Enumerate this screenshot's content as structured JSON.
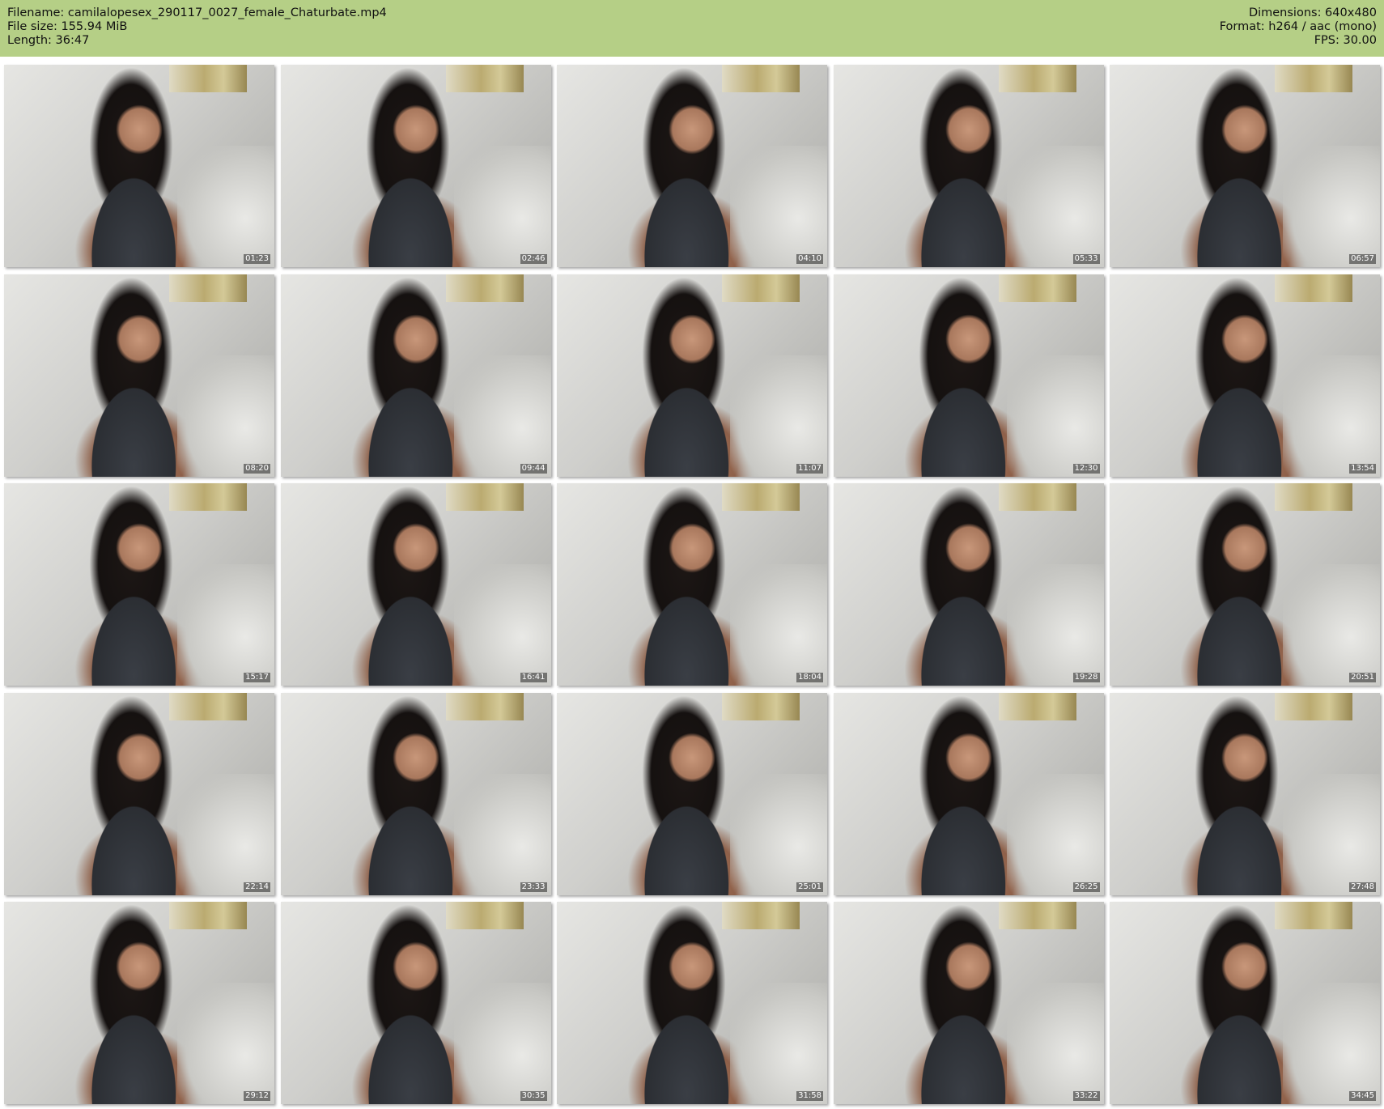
{
  "info": {
    "filename_line": "Filename: camilalopesex_290117_0027_female_Chaturbate.mp4",
    "filesize_line": "File size: 155.94 MiB",
    "length_line": "Length: 36:47",
    "dimensions_line": "Dimensions: 640x480",
    "format_line": "Format: h264 / aac (mono)",
    "fps_line": "FPS: 30.00"
  },
  "colors": {
    "header_background": "#b5cf86",
    "page_background": "#ffffff"
  },
  "thumbnails": [
    {
      "timestamp": "01:23"
    },
    {
      "timestamp": "02:46"
    },
    {
      "timestamp": "04:10"
    },
    {
      "timestamp": "05:33"
    },
    {
      "timestamp": "06:57"
    },
    {
      "timestamp": "08:20"
    },
    {
      "timestamp": "09:44"
    },
    {
      "timestamp": "11:07"
    },
    {
      "timestamp": "12:30"
    },
    {
      "timestamp": "13:54"
    },
    {
      "timestamp": "15:17"
    },
    {
      "timestamp": "16:41"
    },
    {
      "timestamp": "18:04"
    },
    {
      "timestamp": "19:28"
    },
    {
      "timestamp": "20:51"
    },
    {
      "timestamp": "22:14"
    },
    {
      "timestamp": "23:33"
    },
    {
      "timestamp": "25:01"
    },
    {
      "timestamp": "26:25"
    },
    {
      "timestamp": "27:48"
    },
    {
      "timestamp": "29:12"
    },
    {
      "timestamp": "30:35"
    },
    {
      "timestamp": "31:58"
    },
    {
      "timestamp": "33:22"
    },
    {
      "timestamp": "34:45"
    }
  ]
}
